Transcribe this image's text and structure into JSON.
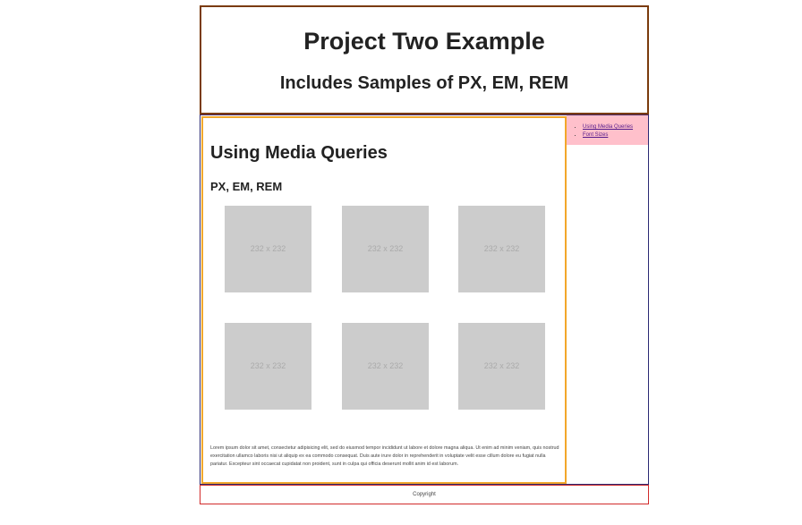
{
  "header": {
    "title": "Project Two Example",
    "subtitle": "Includes Samples of PX, EM, REM"
  },
  "main": {
    "title": "Using Media Queries",
    "subtitle": "PX, EM, REM",
    "thumbnails": [
      {
        "label": "232 x 232"
      },
      {
        "label": "232 x 232"
      },
      {
        "label": "232 x 232"
      },
      {
        "label": "232 x 232"
      },
      {
        "label": "232 x 232"
      },
      {
        "label": "232 x 232"
      }
    ],
    "lorem": "Lorem ipsum dolor sit amet, consectetur adipisicing elit, sed do eiusmod tempor incididunt ut labore et dolore magna aliqua. Ut enim ad minim veniam, quis nostrud exercitation ullamco laboris nisi ut aliquip ex ea commodo consequat. Duis aute irure dolor in reprehenderit in voluptate velit esse cillum dolore eu fugiat nulla pariatur. Excepteur sint occaecat cupidatat non proident, sunt in culpa qui officia deserunt mollit anim id est laborum."
  },
  "sidebar": {
    "links": [
      {
        "label": "Using Media Queries"
      },
      {
        "label": "Font Sizes"
      }
    ]
  },
  "footer": {
    "text": "Copyright"
  },
  "colors": {
    "header_border": "#7a3b0c",
    "content_border": "#2b2a74",
    "article_border": "#f2a72b",
    "sidebar_bg": "#ffc0cb",
    "footer_border": "#d22b2b",
    "placeholder_bg": "#cccccc"
  }
}
